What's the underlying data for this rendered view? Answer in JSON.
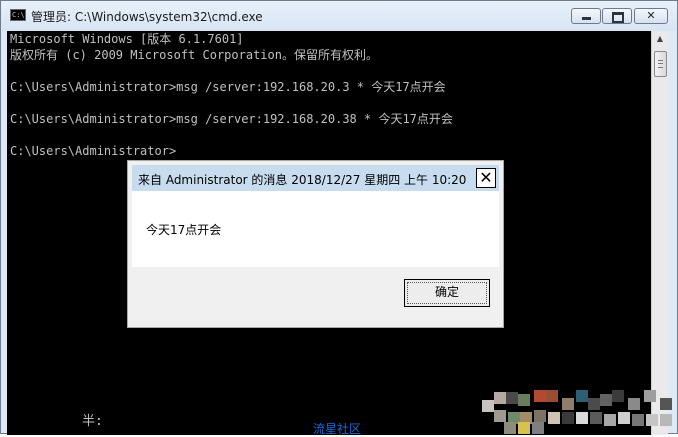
{
  "window": {
    "title": "管理员: C:\\Windows\\system32\\cmd.exe",
    "icon": "cmd-icon",
    "controls": {
      "minimize_icon": "minimize-icon",
      "maximize_icon": "maximize-icon",
      "close_label": "✕"
    }
  },
  "console": {
    "lines": [
      "Microsoft Windows [版本 6.1.7601]",
      "版权所有 (c) 2009 Microsoft Corporation。保留所有权利。",
      "",
      "C:\\Users\\Administrator>msg /server:192.168.20.3 * 今天17点开会",
      "",
      "C:\\Users\\Administrator>msg /server:192.168.20.38 * 今天17点开会",
      "",
      "C:\\Users\\Administrator>"
    ],
    "status_text": "半:"
  },
  "scrollbar": {
    "up_arrow": "▲"
  },
  "message_box": {
    "title": "来自 Administrator 的消息 2018/12/27 星期四 上午 10:20",
    "close_label": "✕",
    "message": "今天17点开会",
    "ok_label": "确定"
  },
  "watermark": {
    "text": "流星社区"
  },
  "colors": {
    "console_bg": "#000000",
    "console_fg": "#c0c0c0",
    "dialog_title_bg": "#c8dcf0",
    "watermark": "#1c6ad6"
  }
}
